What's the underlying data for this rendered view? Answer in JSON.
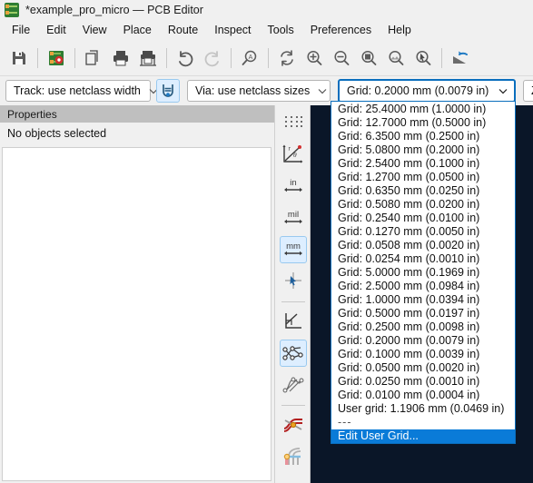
{
  "window": {
    "title": "*example_pro_micro — PCB Editor",
    "app_icon": "pcb-board-icon"
  },
  "menubar": {
    "items": [
      {
        "label": "File",
        "mnemonic": "F"
      },
      {
        "label": "Edit",
        "mnemonic": "E"
      },
      {
        "label": "View",
        "mnemonic": "V"
      },
      {
        "label": "Place",
        "mnemonic": "P"
      },
      {
        "label": "Route",
        "mnemonic": "u"
      },
      {
        "label": "Inspect",
        "mnemonic": "I"
      },
      {
        "label": "Tools",
        "mnemonic": "T"
      },
      {
        "label": "Preferences",
        "mnemonic": "r"
      },
      {
        "label": "Help",
        "mnemonic": "H"
      }
    ]
  },
  "toolbar": {
    "buttons": [
      {
        "name": "save-button",
        "icon": "floppy-disk-icon",
        "enabled": true
      },
      {
        "name": "board-setup-button",
        "icon": "board-setup-icon",
        "enabled": true
      },
      {
        "name": "page-settings-button",
        "icon": "page-settings-icon",
        "enabled": true
      },
      {
        "name": "print-button",
        "icon": "printer-icon",
        "enabled": true
      },
      {
        "name": "plot-button",
        "icon": "plotter-icon",
        "enabled": true
      },
      {
        "name": "undo-button",
        "icon": "undo-arrow-icon",
        "enabled": true
      },
      {
        "name": "redo-button",
        "icon": "redo-arrow-icon",
        "enabled": false
      },
      {
        "name": "find-button",
        "icon": "search-a-icon",
        "enabled": true
      },
      {
        "name": "refresh-button",
        "icon": "refresh-icon",
        "enabled": true
      },
      {
        "name": "zoom-in-button",
        "icon": "zoom-in-icon",
        "enabled": true
      },
      {
        "name": "zoom-out-button",
        "icon": "zoom-out-icon",
        "enabled": true
      },
      {
        "name": "zoom-fit-page-button",
        "icon": "zoom-fit-page-icon",
        "enabled": true
      },
      {
        "name": "zoom-fit-objects-button",
        "icon": "zoom-fit-objects-icon",
        "enabled": true
      },
      {
        "name": "zoom-select-button",
        "icon": "zoom-selection-icon",
        "enabled": true
      },
      {
        "name": "flip-board-button",
        "icon": "flip-board-icon",
        "enabled": true
      }
    ]
  },
  "toolbar2": {
    "track_combo": {
      "value": "Track: use netclass width",
      "name": "track-width-combo"
    },
    "track_toggle": {
      "name": "auto-track-width-toggle",
      "icon": "track-width-auto-icon",
      "active": true
    },
    "via_combo": {
      "value": "Via: use netclass sizes",
      "name": "via-size-combo"
    },
    "grid_combo": {
      "value": "Grid: 0.2000 mm (0.0079 in)",
      "name": "grid-combo",
      "focused": true
    },
    "zoom_combo": {
      "value": "Zo",
      "name": "zoom-combo"
    }
  },
  "properties_panel": {
    "title": "Properties",
    "status": "No objects selected"
  },
  "sidebar": {
    "items": [
      {
        "name": "sidebar-item-grid-display",
        "icon": "grid-dots-icon",
        "active": false
      },
      {
        "name": "sidebar-item-polar-coords",
        "icon": "polar-coordinates-icon",
        "active": false
      },
      {
        "name": "sidebar-item-units-inches",
        "icon": "inches-icon",
        "label": "in",
        "active": false
      },
      {
        "name": "sidebar-item-units-mils",
        "icon": "mils-icon",
        "label": "mil",
        "active": false
      },
      {
        "name": "sidebar-item-units-mm",
        "icon": "millimeters-icon",
        "label": "mm",
        "active": true
      },
      {
        "name": "sidebar-item-full-crosshair",
        "icon": "crosshair-cursor-icon",
        "active": false
      },
      {
        "name": "sidebar-item-drawing-sheet",
        "icon": "drawing-sheet-icon",
        "active": false
      },
      {
        "name": "sidebar-item-show-ratsnest",
        "icon": "ratsnest-icon",
        "active": true
      },
      {
        "name": "sidebar-item-curved-ratsnest",
        "icon": "curved-ratsnest-icon",
        "active": false
      },
      {
        "name": "sidebar-item-net-colors",
        "icon": "net-colors-icon",
        "active": false
      },
      {
        "name": "sidebar-item-ratsnest-mode",
        "icon": "ratsnest-mode-icon",
        "active": false
      }
    ]
  },
  "grid_dropdown": {
    "name": "grid-dropdown-list",
    "options": [
      "Grid: 25.4000 mm (1.0000 in)",
      "Grid: 12.7000 mm (0.5000 in)",
      "Grid: 6.3500 mm (0.2500 in)",
      "Grid: 5.0800 mm (0.2000 in)",
      "Grid: 2.5400 mm (0.1000 in)",
      "Grid: 1.2700 mm (0.0500 in)",
      "Grid: 0.6350 mm (0.0250 in)",
      "Grid: 0.5080 mm (0.0200 in)",
      "Grid: 0.2540 mm (0.0100 in)",
      "Grid: 0.1270 mm (0.0050 in)",
      "Grid: 0.0508 mm (0.0020 in)",
      "Grid: 0.0254 mm (0.0010 in)",
      "Grid: 5.0000 mm (0.1969 in)",
      "Grid: 2.5000 mm (0.0984 in)",
      "Grid: 1.0000 mm (0.0394 in)",
      "Grid: 0.5000 mm (0.0197 in)",
      "Grid: 0.2500 mm (0.0098 in)",
      "Grid: 0.2000 mm (0.0079 in)",
      "Grid: 0.1000 mm (0.0039 in)",
      "Grid: 0.0500 mm (0.0020 in)",
      "Grid: 0.0250 mm (0.0010 in)",
      "Grid: 0.0100 mm (0.0004 in)",
      "User grid: 1.1906 mm (0.0469 in)",
      "---",
      "Edit User Grid..."
    ],
    "selected_index": 24,
    "separator_index": 23,
    "highlight_color": "#0a7bd8"
  },
  "colors": {
    "canvas_background": "#0a1628",
    "chrome_background": "#f0f0f0",
    "dock_title_background": "#bfbfbf",
    "accent": "#0a6ebd",
    "toggle_active_background": "#ddeeff"
  }
}
